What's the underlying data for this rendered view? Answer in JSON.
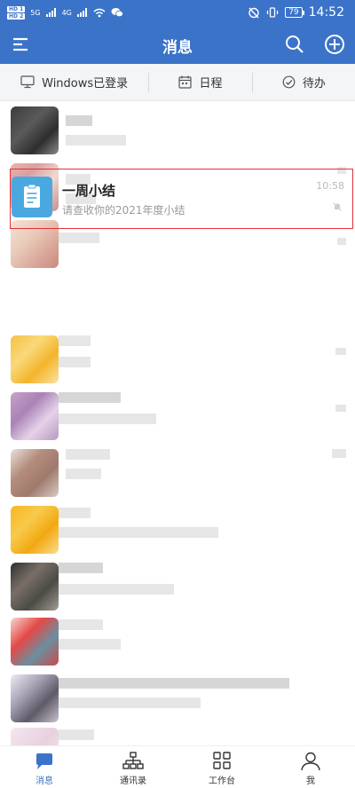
{
  "status_bar": {
    "hd1": "HD 1",
    "hd2": "HD 2",
    "signal1": "5G",
    "signal2": "4G",
    "battery": "79",
    "time": "14:52"
  },
  "app_bar": {
    "title": "消息",
    "icons": [
      "menu-icon",
      "search-icon",
      "add-icon"
    ]
  },
  "sub_bar": {
    "items": [
      {
        "icon": "monitor-icon",
        "label": "Windows已登录"
      },
      {
        "icon": "calendar-icon",
        "label": "日程"
      },
      {
        "icon": "check-circle-icon",
        "label": "待办"
      }
    ]
  },
  "highlighted_message": {
    "title": "一周小结",
    "subtitle": "请查收你的2021年度小结",
    "time": "10:58",
    "icon": "document-icon",
    "muted_icon": "bell-off-icon"
  },
  "bottom_nav": {
    "items": [
      {
        "label": "消息",
        "icon": "chat-bubble-icon",
        "active": true
      },
      {
        "label": "通讯录",
        "icon": "org-chart-icon",
        "active": false
      },
      {
        "label": "工作台",
        "icon": "grid-icon",
        "active": false
      },
      {
        "label": "我",
        "icon": "person-icon",
        "active": false
      }
    ]
  },
  "colors": {
    "brand": "#3b73c9",
    "highlight_border": "#e0323a",
    "doc_icon_bg": "#4aa8e0"
  }
}
